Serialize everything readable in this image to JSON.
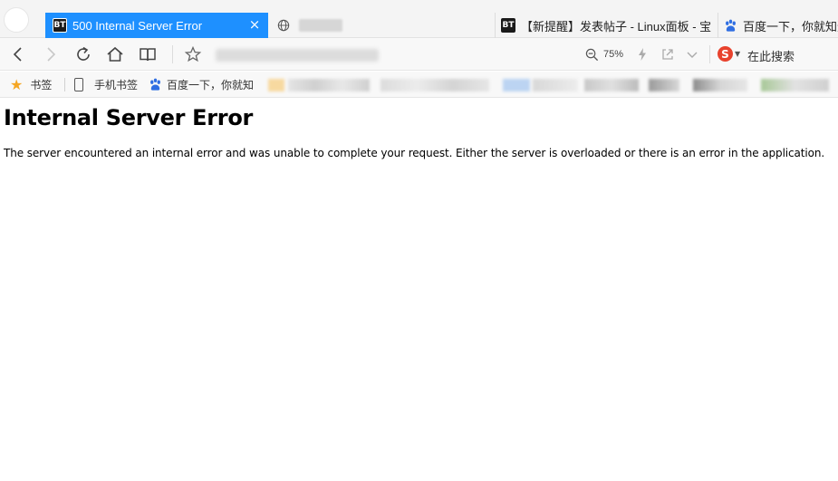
{
  "tabs": [
    {
      "icon": "bt-icon",
      "badge": "BT",
      "title": "500 Internal Server Error",
      "active": true
    },
    {
      "icon": "globe-icon",
      "title": "",
      "active": false
    },
    {
      "icon": "bt-icon",
      "badge": "BT",
      "title": "【新提醒】发表帖子 - Linux面板 - 宝",
      "active": false
    },
    {
      "icon": "baidu-paw-icon",
      "title": "百度一下，你就知道",
      "active": false
    }
  ],
  "toolbar": {
    "zoom_level": "75%",
    "search_label": "在此搜索",
    "search_engine_letter": "S"
  },
  "bookmarks": {
    "items": [
      {
        "label": "书签"
      },
      {
        "label": "手机书签"
      },
      {
        "label": "百度一下，你就知"
      }
    ]
  },
  "page": {
    "heading": "Internal Server Error",
    "message": "The server encountered an internal error and was unable to complete your request. Either the server is overloaded or there is an error in the application."
  },
  "colors": {
    "active_tab": "#1e90ff",
    "bookmark_star": "#f5a623",
    "sogou": "#e8422d",
    "baidu": "#2f6ee2"
  }
}
